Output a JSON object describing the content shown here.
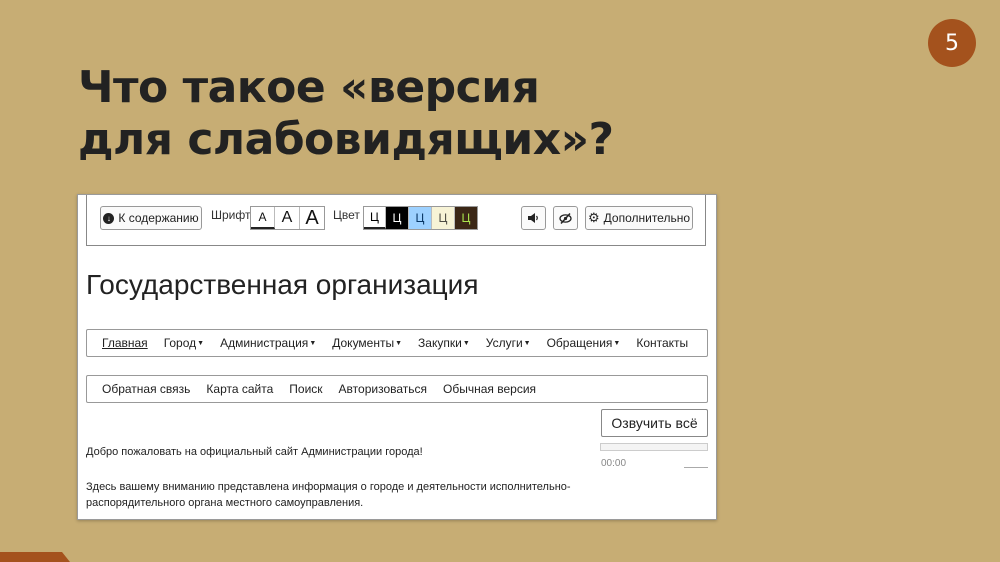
{
  "slide": {
    "page_number": "5",
    "title_lines": [
      "Что такое «версия",
      "для слабовидящих»?"
    ]
  },
  "accessibility_panel": {
    "skip_button": "К содержанию",
    "font_label": "Шрифт",
    "font_sizes": [
      "А",
      "А",
      "А"
    ],
    "color_label": "Цвет",
    "color_schemes": [
      {
        "label": "Ц",
        "bg": "#ffffff",
        "fg": "#000000"
      },
      {
        "label": "Ц",
        "bg": "#000000",
        "fg": "#ffffff"
      },
      {
        "label": "Ц",
        "bg": "#9dd1ff",
        "fg": "#063462"
      },
      {
        "label": "Ц",
        "bg": "#f7f3d6",
        "fg": "#4d4b43"
      },
      {
        "label": "Ц",
        "bg": "#3b2716",
        "fg": "#a9e44d"
      }
    ],
    "sound_icon": "speaker-icon",
    "images_icon": "eye-slash-icon",
    "more_button": "Дополнительно"
  },
  "site": {
    "title": "Государственная организация",
    "main_nav": [
      {
        "label": "Главная",
        "dropdown": false
      },
      {
        "label": "Город",
        "dropdown": true
      },
      {
        "label": "Администрация",
        "dropdown": true
      },
      {
        "label": "Документы",
        "dropdown": true
      },
      {
        "label": "Закупки",
        "dropdown": true
      },
      {
        "label": "Услуги",
        "dropdown": true
      },
      {
        "label": "Обращения",
        "dropdown": true
      },
      {
        "label": "Контакты",
        "dropdown": false
      }
    ],
    "util_nav": [
      "Обратная связь",
      "Карта сайта",
      "Поиск",
      "Авторизоваться",
      "Обычная версия"
    ],
    "speak_button": "Озвучить всё",
    "player_time": "00:00",
    "welcome_text": "Добро пожаловать на официальный сайт Администрации города!",
    "info_text": "Здесь вашему вниманию представлена информация о городе и деятельности исполнительно-распорядительного органа местного самоуправления."
  },
  "colors": {
    "slide_background": "#c7ad74",
    "accent": "#a4521d"
  }
}
